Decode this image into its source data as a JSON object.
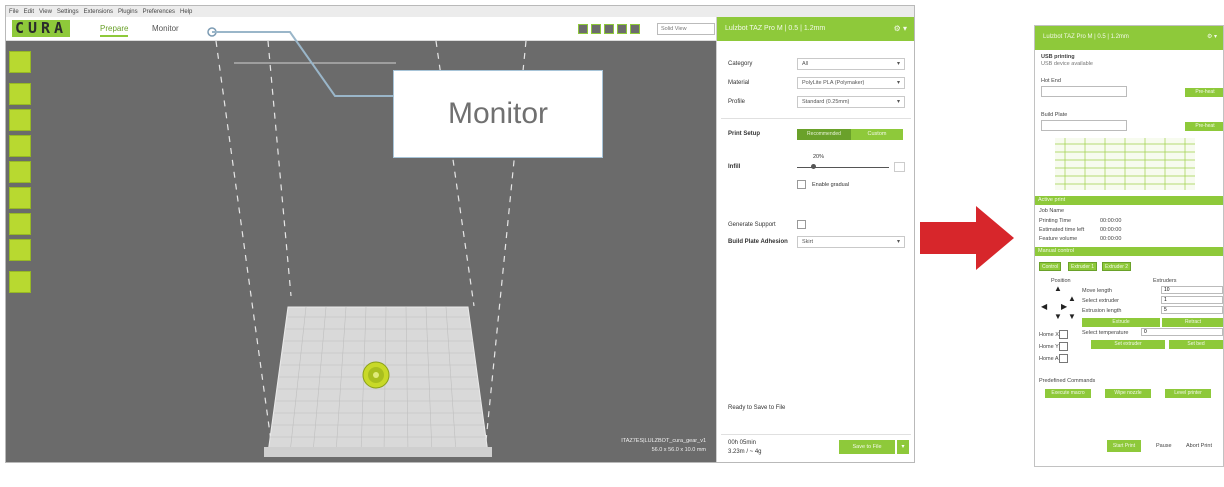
{
  "app": {
    "menu": [
      "File",
      "Edit",
      "View",
      "Settings",
      "Extensions",
      "Plugins",
      "Preferences",
      "Help"
    ],
    "logo": "CURA",
    "tabs": {
      "prepare": "Prepare",
      "monitor": "Monitor"
    },
    "view_select": "Solid View"
  },
  "right_panel": {
    "header": "Lulzbot TAZ Pro M | 0.5 | 1.2mm",
    "category_label": "Category",
    "category_value": "All",
    "material_label": "Material",
    "material_value": "PolyLite PLA (Polymaker)",
    "profile_label": "Profile",
    "profile_value": "Standard (0.25mm)",
    "print_setup_label": "Print Setup",
    "mode_recommended": "Recommended",
    "mode_custom": "Custom",
    "infill_label": "Infill",
    "infill_value": "20%",
    "gradual_label": "Enable gradual",
    "support_label": "Generate Support",
    "adhesion_label": "Build Plate Adhesion",
    "adhesion_value": "Skirt",
    "ready_label": "Ready to Save to File",
    "model_name": "ITAZ7ES|LULZBOT_cura_gear_v1",
    "model_dims": "56.0 x 56.0 x 10.0 mm",
    "print_time": "00h 05min",
    "filament": "3.23m / ~ 4g",
    "save_button": "Save to File"
  },
  "callout": {
    "text": "Monitor"
  },
  "monitor_panel": {
    "header": "Lulzbot TAZ Pro M | 0.5 | 1.2mm",
    "usb_title": "USB printing",
    "usb_subtitle": "USB device available",
    "hot_end_label": "Hot End",
    "bed_label": "Build Plate",
    "preheat_label": "Pre-heat",
    "active_print_label": "Active print",
    "job_name_label": "Job Name",
    "printing_time_label": "Printing Time",
    "estimated_time_label": "Estimated time left",
    "printing_time_value": "00:00:00",
    "estimated_time_value": "00:00:00",
    "feature_label": "Feature volume",
    "feature_value": "00:00:00",
    "manual_control_label": "Manual control",
    "control_tabs": [
      "Control",
      "Extruder 1",
      "Extruder 2"
    ],
    "position_label": "Position",
    "extruders_label": "Extruders",
    "move_length_label": "Move length",
    "move_length_value": "10",
    "select_extruder_label": "Select extruder",
    "select_extruder_value": "1",
    "extrusion_length_label": "Extrusion length",
    "extrusion_length_value": "5",
    "extrude_button": "Extrude",
    "retract_button": "Retract",
    "select_temp_label": "Select temperature",
    "select_temp_value": "0",
    "set_extruder_button": "Set extruder",
    "set_bed_button": "Set bed",
    "home_x": "Home X",
    "home_y": "Home Y",
    "home_all": "Home All",
    "printer_commands_label": "Predefined Commands",
    "cmd_1": "Execute macro",
    "cmd_2": "Wipe nozzle",
    "cmd_3": "Level printer",
    "start_print": "Start Print",
    "pause": "Pause",
    "abort_print": "Abort Print"
  },
  "colors": {
    "accent": "#8ec93a",
    "arrow": "#d7262b",
    "viewport": "#6b6b6b"
  }
}
